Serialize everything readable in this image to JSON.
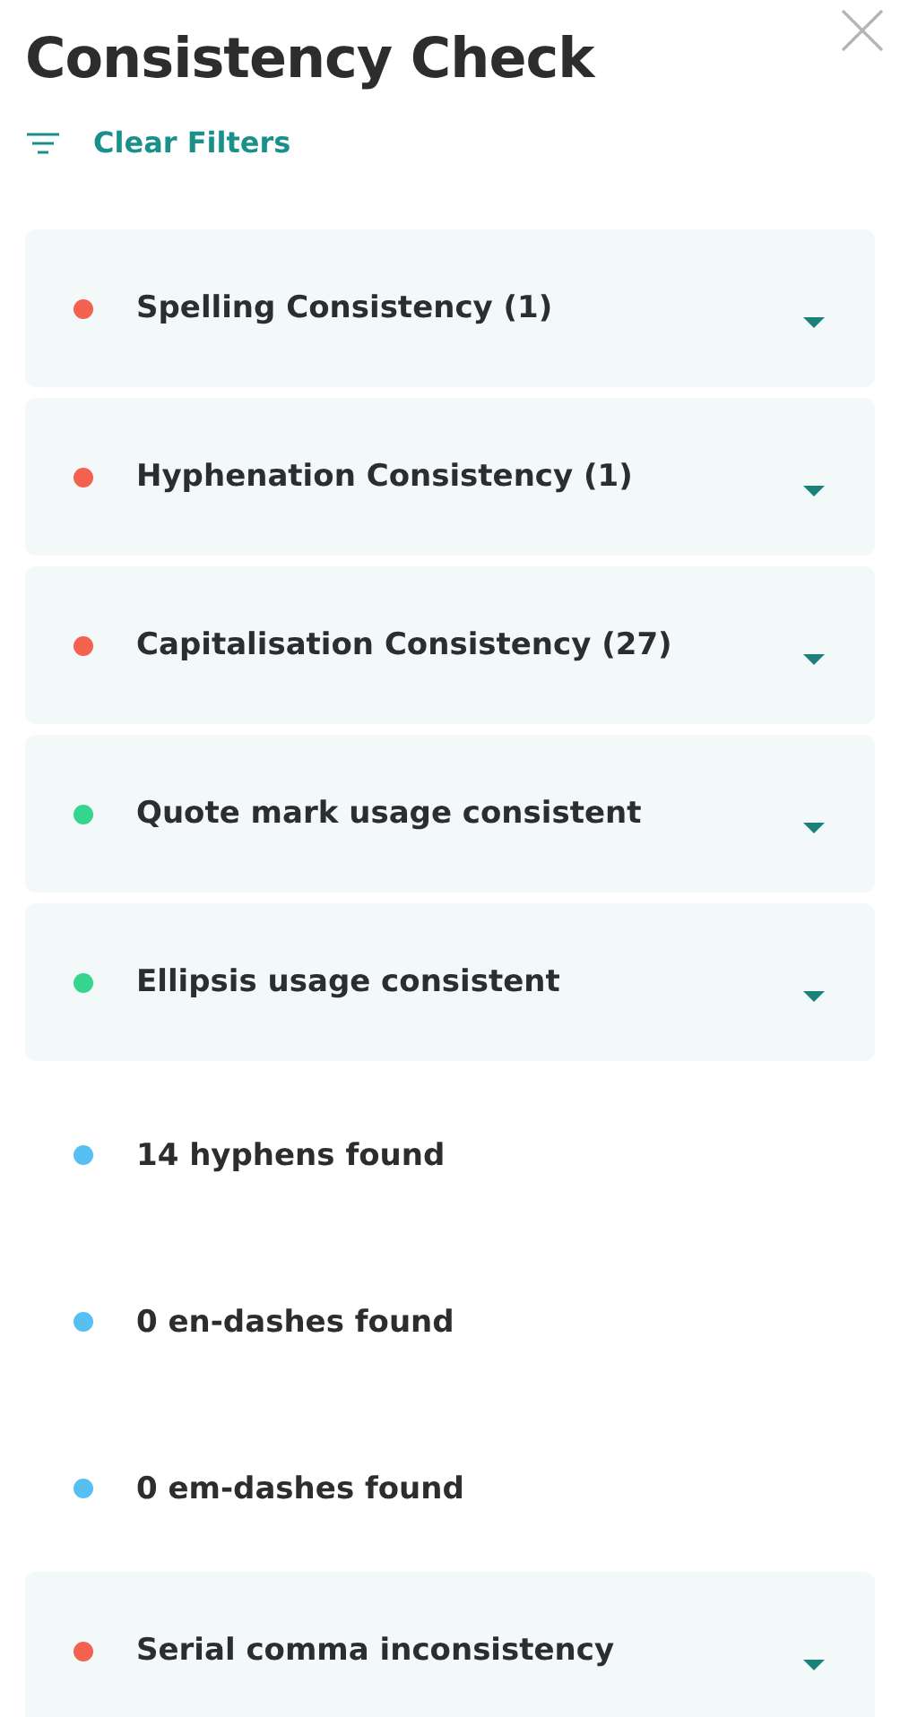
{
  "title": "Consistency Check",
  "clear_filters": "Clear Filters",
  "checks": [
    {
      "kind": "expandable",
      "label": "Spelling Consistency (1)",
      "color": "#f2624f",
      "expanded": false
    },
    {
      "kind": "expandable",
      "label": "Hyphenation Consistency (1)",
      "color": "#f2624f",
      "expanded": false
    },
    {
      "kind": "expandable",
      "label": "Capitalisation Consistency (27)",
      "color": "#f2624f",
      "expanded": false
    },
    {
      "kind": "expandable",
      "label": "Quote mark usage consistent",
      "color": "#35d48f",
      "expanded": false
    },
    {
      "kind": "expandable",
      "label": "Ellipsis usage consistent",
      "color": "#35d48f",
      "expanded": false
    },
    {
      "kind": "info",
      "label": "14 hyphens found",
      "color": "#58bff2"
    },
    {
      "kind": "info",
      "label": "0 en-dashes found",
      "color": "#58bff2"
    },
    {
      "kind": "info",
      "label": "0 em-dashes found",
      "color": "#58bff2"
    },
    {
      "kind": "expandable",
      "label": "Serial comma inconsistency",
      "color": "#f2624f",
      "expanded": false
    }
  ]
}
